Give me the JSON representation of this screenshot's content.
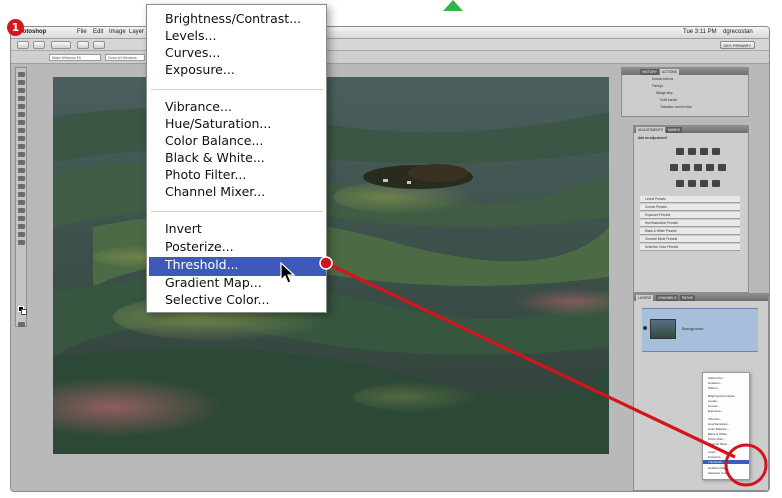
{
  "step_number": "1",
  "menubar": {
    "app_name": "Photoshop",
    "items": [
      "File",
      "Edit",
      "Image",
      "Layer"
    ],
    "clock": "Tue 3:11 PM",
    "user": "dgrecostan"
  },
  "workspace_button": "DES PRIMARY",
  "options_fields": [
    "Make Windows Fit",
    "Zoom All Windows"
  ],
  "adjustment_menu": {
    "group1": [
      "Brightness/Contrast...",
      "Levels...",
      "Curves...",
      "Exposure..."
    ],
    "group2": [
      "Vibrance...",
      "Hue/Saturation...",
      "Color Balance...",
      "Black & White...",
      "Photo Filter...",
      "Channel Mixer..."
    ],
    "group3": [
      "Invert",
      "Posterize...",
      "Threshold...",
      "Gradient Map...",
      "Selective Color..."
    ],
    "selected": "Threshold..."
  },
  "history_panel": {
    "tabs": [
      "HISTORY",
      "ACTIONS"
    ],
    "rows": [
      "Default Actions",
      "Fisheye",
      "Mirage step",
      "Solid border",
      "Transition current slice"
    ]
  },
  "adjustments_panel": {
    "tabs": [
      "ADJUSTMENTS",
      "MASKS"
    ],
    "heading": "Add an adjustment",
    "presets": [
      "Levels Presets",
      "Curves Presets",
      "Exposure Presets",
      "Hue/Saturation Presets",
      "Black & White Presets",
      "Channel Mixer Presets",
      "Selective Color Presets"
    ]
  },
  "layers_panel": {
    "tabs": [
      "LAYERS",
      "CHANNELS",
      "PATHS"
    ],
    "layer_name": "Background"
  },
  "mini_menu_items": [
    "Solid Color...",
    "Gradient...",
    "Pattern...",
    "Brightness/Contrast...",
    "Levels...",
    "Curves...",
    "Exposure...",
    "Vibrance...",
    "Hue/Saturation...",
    "Color Balance...",
    "Black & White...",
    "Photo Filter...",
    "Channel Mixer...",
    "Invert",
    "Posterize...",
    "Threshold...",
    "Gradient Map...",
    "Selective Color..."
  ],
  "colors": {
    "badge": "#d6141c",
    "annotation_line": "#d4141c",
    "menu_highlight": "#3d5ab8",
    "green_arrow": "#2fb44a"
  }
}
